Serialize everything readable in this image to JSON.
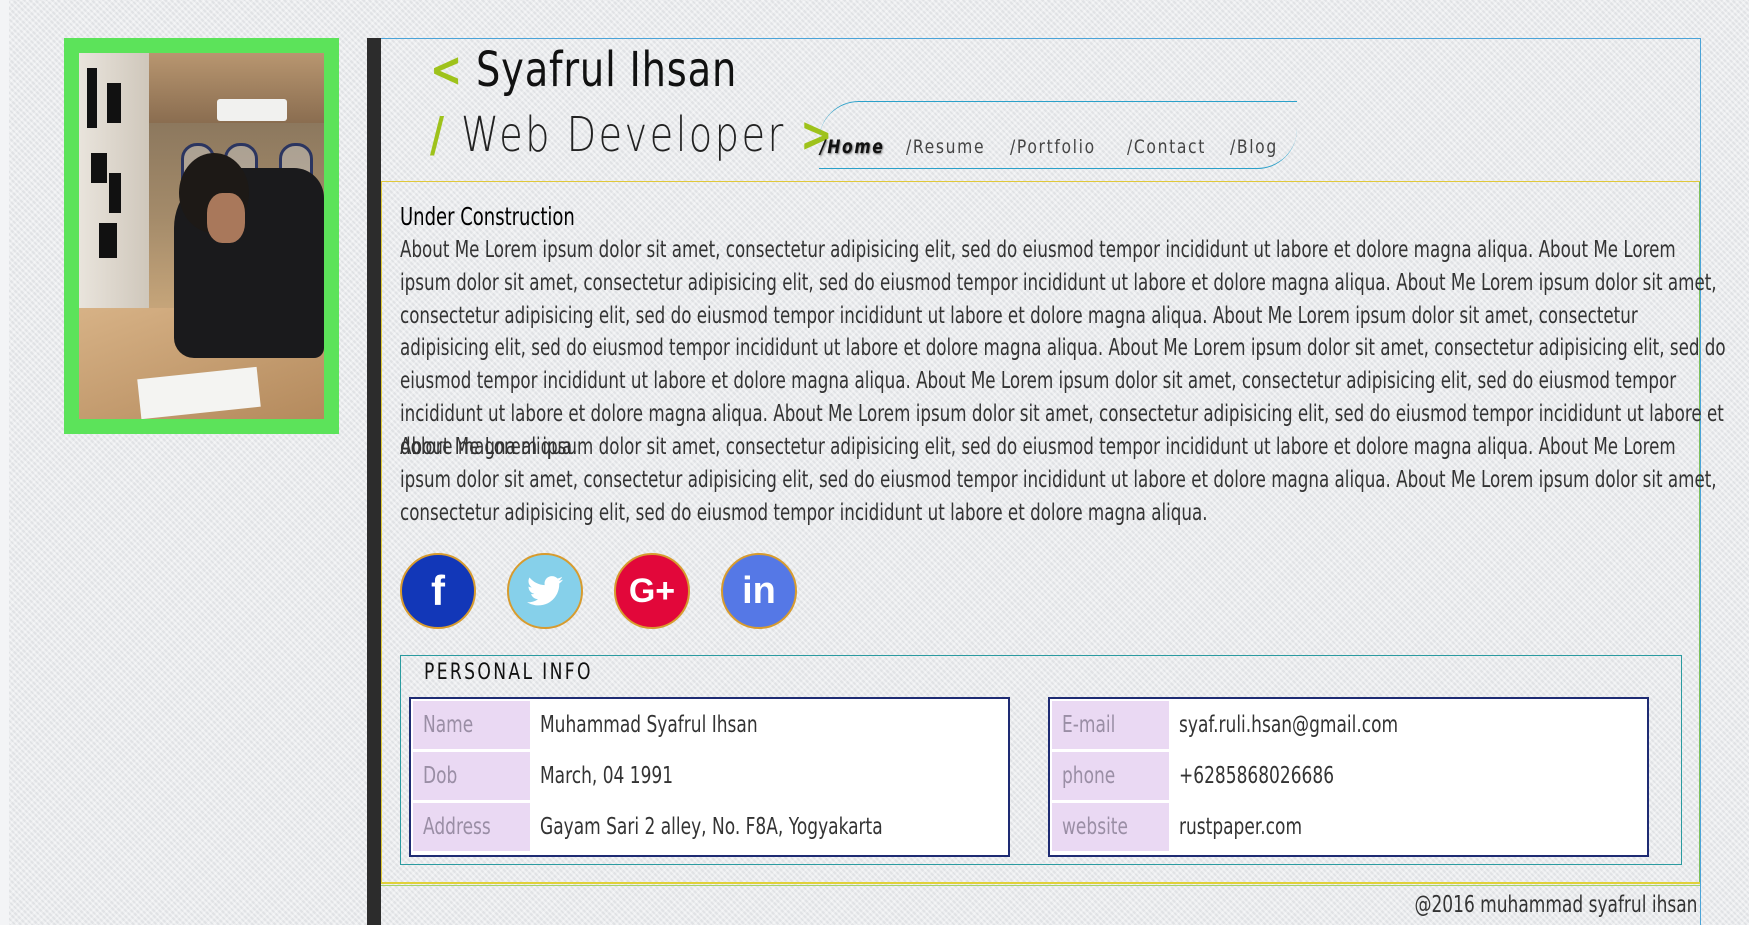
{
  "header": {
    "name_prefix": "<",
    "name": "Syafrul Ihsan",
    "role_prefix": "/",
    "role": "Web Developer",
    "role_suffix": ">"
  },
  "nav": {
    "items": [
      {
        "label": "/Home",
        "active": true
      },
      {
        "label": "/Resume",
        "active": false
      },
      {
        "label": "/Portfolio",
        "active": false
      },
      {
        "label": "/Contact",
        "active": false
      },
      {
        "label": "/Blog",
        "active": false
      }
    ]
  },
  "main": {
    "heading": "Under Construction",
    "paragraph1": "About Me Lorem ipsum dolor sit amet, consectetur adipisicing elit, sed do eiusmod tempor incididunt ut labore et dolore magna aliqua. About Me Lorem ipsum dolor sit amet, consectetur adipisicing elit, sed do eiusmod tempor incididunt ut labore et dolore magna aliqua. About Me Lorem ipsum dolor sit amet, consectetur adipisicing elit, sed do eiusmod tempor incididunt ut labore et dolore magna aliqua. About Me Lorem ipsum dolor sit amet, consectetur adipisicing elit, sed do eiusmod tempor incididunt ut labore et dolore magna aliqua. About Me Lorem ipsum dolor sit amet, consectetur adipisicing elit, sed do eiusmod tempor incididunt ut labore et dolore magna aliqua. About Me Lorem ipsum dolor sit amet, consectetur adipisicing elit, sed do eiusmod tempor incididunt ut labore et dolore magna aliqua. About Me Lorem ipsum dolor sit amet, consectetur adipisicing elit, sed do eiusmod tempor incididunt ut labore et dolore magna aliqua.",
    "paragraph2": "About Me Lorem ipsum dolor sit amet, consectetur adipisicing elit, sed do eiusmod tempor incididunt ut labore et dolore magna aliqua. About Me Lorem ipsum dolor sit amet, consectetur adipisicing elit, sed do eiusmod tempor incididunt ut labore et dolore magna aliqua. About Me Lorem ipsum dolor sit amet, consectetur adipisicing elit, sed do eiusmod tempor incididunt ut labore et dolore magna aliqua."
  },
  "social": [
    {
      "icon": "facebook-icon",
      "glyph": "f",
      "color": "#1237b8"
    },
    {
      "icon": "twitter-icon",
      "glyph": "",
      "color": "#86d0ea"
    },
    {
      "icon": "google-plus-icon",
      "glyph": "G+",
      "color": "#e2073a"
    },
    {
      "icon": "linkedin-icon",
      "glyph": "in",
      "color": "#5578e6"
    }
  ],
  "personal_info": {
    "title": "PERSONAL INFO",
    "left": [
      {
        "label": "Name",
        "value": "Muhammad Syafrul Ihsan"
      },
      {
        "label": "Dob",
        "value": "March, 04 1991"
      },
      {
        "label": "Address",
        "value": "Gayam Sari 2 alley, No. F8A, Yogyakarta"
      }
    ],
    "right": [
      {
        "label": "E-mail",
        "value": "syaf.ruli.hsan@gmail.com"
      },
      {
        "label": "phone",
        "value": "+6285868026686"
      },
      {
        "label": "website",
        "value": "rustpaper.com"
      }
    ]
  },
  "footer": {
    "text": "@2016 muhammad syafrul ihsan"
  },
  "colors": {
    "accent": "#9ec21b",
    "photo_frame": "#5ce35a",
    "nav_line": "#2aa0c9",
    "table_border": "#1e2b73",
    "label_bg": "#ead9f3"
  }
}
